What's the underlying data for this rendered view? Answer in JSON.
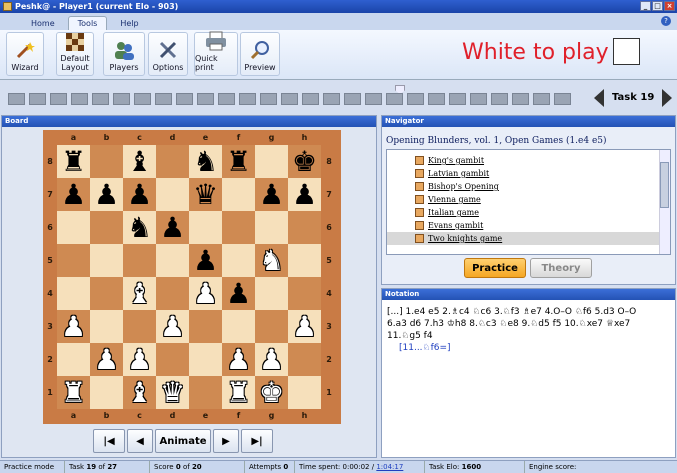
{
  "window": {
    "title": "Peshk@ - Player1 (current Elo - 903)"
  },
  "tabs": [
    "Home",
    "Tools",
    "Help"
  ],
  "ribbon": {
    "wizard": "Wizard",
    "default_layout_1": "Default",
    "default_layout_2": "Layout",
    "players": "Players",
    "options": "Options",
    "quick_print": "Quick print",
    "preview": "Preview"
  },
  "to_move": "White to play",
  "task_label": "Task  19",
  "board": {
    "title": "Board",
    "files": [
      "a",
      "b",
      "c",
      "d",
      "e",
      "f",
      "g",
      "h"
    ],
    "ranks": [
      "8",
      "7",
      "6",
      "5",
      "4",
      "3",
      "2",
      "1"
    ],
    "rows": [
      [
        "br",
        "",
        "bb",
        "",
        "bn",
        "br",
        "",
        "bk"
      ],
      [
        "bp",
        "bp",
        "bp",
        "",
        "bq",
        "",
        "bp",
        "bp"
      ],
      [
        "",
        "",
        "bn",
        "bp",
        "",
        "",
        "",
        ""
      ],
      [
        "",
        "",
        "",
        "",
        "bp",
        "",
        "wn",
        ""
      ],
      [
        "",
        "",
        "wb",
        "",
        "wp",
        "bp",
        "",
        ""
      ],
      [
        "wp",
        "",
        "",
        "wp",
        "",
        "",
        "",
        "wp"
      ],
      [
        "",
        "wp",
        "wp",
        "",
        "",
        "wp",
        "wp",
        ""
      ],
      [
        "wr",
        "",
        "wb",
        "wq",
        "",
        "wr",
        "wk",
        ""
      ]
    ]
  },
  "controls": {
    "animate": "Animate"
  },
  "navigator": {
    "title": "Navigator",
    "book": "Opening Blunders, vol. 1, Open Games (1.e4 e5)",
    "items": [
      "King's gambit",
      "Latvian gambit",
      "Bishop's Opening",
      "Vienna game",
      "Italian game",
      "Evans gambit",
      "Two knights game"
    ],
    "selected": 6,
    "practice": "Practice",
    "theory": "Theory"
  },
  "notation": {
    "title": "Notation",
    "line1": "[...] 1.e4 e5 2.♗c4 ♘c6 3.♘f3 ♗e7 4.O–O ♘f6 5.d3 O–O",
    "line2": "6.a3 d6 7.h3 ♔h8 8.♘c3 ♘e8 9.♘d5 f5 10.♘xe7 ♕xe7",
    "line3": "11.♘g5 f4",
    "variation": "[11...♘f6=]"
  },
  "status": {
    "mode": "Practice mode",
    "task_prefix": "Task",
    "task_num": "19",
    "task_of": "of",
    "task_total": "27",
    "score_prefix": "Score",
    "score": "0",
    "score_of": "of",
    "score_total": "20",
    "attempts_label": "Attempts",
    "attempts": "0",
    "time_label": "Time spent: 0:00:02 /",
    "time_total": "1:04:17",
    "elo_label": "Task Elo:",
    "elo": "1600",
    "engine": "Engine score:"
  },
  "colors": {
    "accent": "#2452b4",
    "to_move": "#e0202a",
    "practice": "#f5a623"
  }
}
